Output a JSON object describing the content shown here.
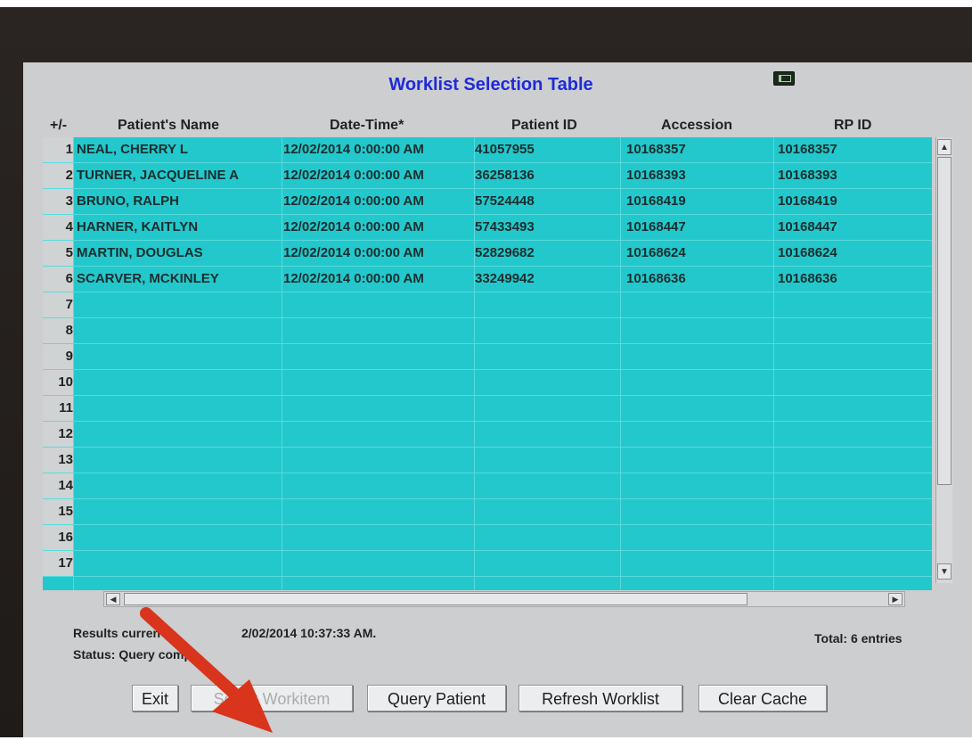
{
  "window": {
    "title": "Worklist Selection Table"
  },
  "table": {
    "headers": {
      "toggle": "+/-",
      "name": "Patient's Name",
      "datetime": "Date-Time*",
      "pid": "Patient ID",
      "accession": "Accession",
      "rpid": "RP ID"
    },
    "rows": [
      {
        "num": "1",
        "name": "NEAL, CHERRY L",
        "datetime": "12/02/2014  0:00:00 AM",
        "pid": "41057955",
        "accession": "10168357",
        "rpid": "10168357"
      },
      {
        "num": "2",
        "name": "TURNER, JACQUELINE A",
        "datetime": "12/02/2014  0:00:00 AM",
        "pid": "36258136",
        "accession": "10168393",
        "rpid": "10168393"
      },
      {
        "num": "3",
        "name": "BRUNO, RALPH",
        "datetime": "12/02/2014  0:00:00 AM",
        "pid": "57524448",
        "accession": "10168419",
        "rpid": "10168419"
      },
      {
        "num": "4",
        "name": "HARNER, KAITLYN",
        "datetime": "12/02/2014  0:00:00 AM",
        "pid": "57433493",
        "accession": "10168447",
        "rpid": "10168447"
      },
      {
        "num": "5",
        "name": "MARTIN, DOUGLAS",
        "datetime": "12/02/2014  0:00:00 AM",
        "pid": "52829682",
        "accession": "10168624",
        "rpid": "10168624"
      },
      {
        "num": "6",
        "name": "SCARVER, MCKINLEY",
        "datetime": "12/02/2014  0:00:00 AM",
        "pid": "33249942",
        "accession": "10168636",
        "rpid": "10168636"
      },
      {
        "num": "7",
        "name": "",
        "datetime": "",
        "pid": "",
        "accession": "",
        "rpid": ""
      },
      {
        "num": "8",
        "name": "",
        "datetime": "",
        "pid": "",
        "accession": "",
        "rpid": ""
      },
      {
        "num": "9",
        "name": "",
        "datetime": "",
        "pid": "",
        "accession": "",
        "rpid": ""
      },
      {
        "num": "10",
        "name": "",
        "datetime": "",
        "pid": "",
        "accession": "",
        "rpid": ""
      },
      {
        "num": "11",
        "name": "",
        "datetime": "",
        "pid": "",
        "accession": "",
        "rpid": ""
      },
      {
        "num": "12",
        "name": "",
        "datetime": "",
        "pid": "",
        "accession": "",
        "rpid": ""
      },
      {
        "num": "13",
        "name": "",
        "datetime": "",
        "pid": "",
        "accession": "",
        "rpid": ""
      },
      {
        "num": "14",
        "name": "",
        "datetime": "",
        "pid": "",
        "accession": "",
        "rpid": ""
      },
      {
        "num": "15",
        "name": "",
        "datetime": "",
        "pid": "",
        "accession": "",
        "rpid": ""
      },
      {
        "num": "16",
        "name": "",
        "datetime": "",
        "pid": "",
        "accession": "",
        "rpid": ""
      },
      {
        "num": "17",
        "name": "",
        "datetime": "",
        "pid": "",
        "accession": "",
        "rpid": ""
      }
    ]
  },
  "status": {
    "results_left": "Results curren",
    "results_right": "2/02/2014 10:37:33 AM.",
    "status_text": "Status: Query comp",
    "total": "Total: 6 entries"
  },
  "buttons": {
    "exit": "Exit",
    "select_workitem": "Select Workitem",
    "query_patient": "Query Patient",
    "refresh_worklist": "Refresh Worklist",
    "clear_cache": "Clear Cache"
  },
  "colors": {
    "table_bg": "#22c8cc",
    "title_blue": "#1f2bd8",
    "annotation_arrow": "#d9341c"
  }
}
